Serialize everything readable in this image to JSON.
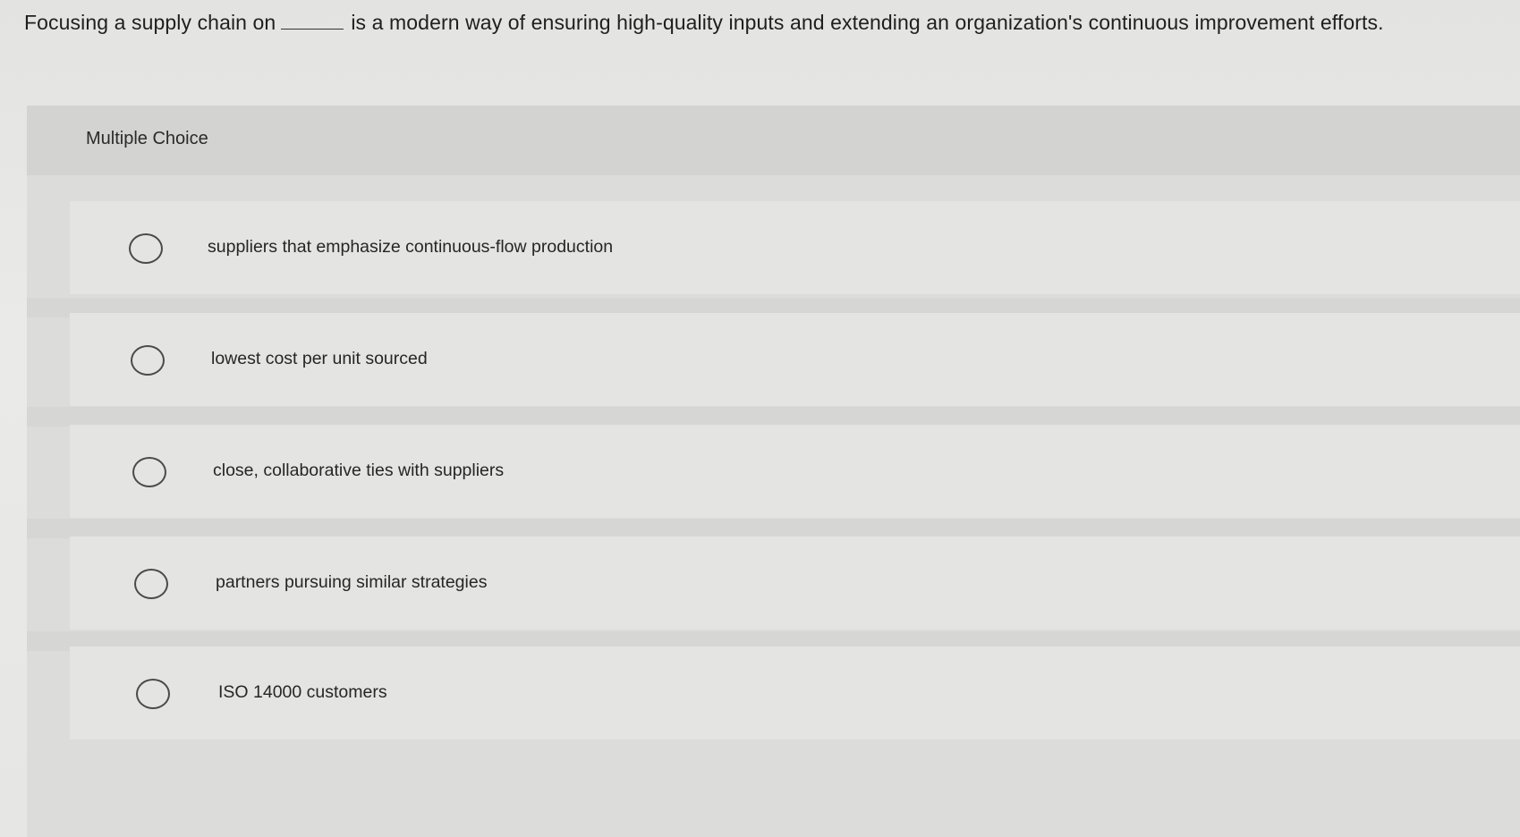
{
  "question": {
    "before_blank": "Focusing a supply chain on",
    "after_blank": "is a modern way of ensuring high-quality inputs and extending an organization's continuous improvement efforts."
  },
  "panel": {
    "title": "Multiple Choice"
  },
  "options": [
    {
      "label": "suppliers that emphasize continuous-flow production"
    },
    {
      "label": "lowest cost per unit sourced"
    },
    {
      "label": "close, collaborative ties with suppliers"
    },
    {
      "label": "partners pursuing similar strategies"
    },
    {
      "label": "ISO 14000 customers"
    }
  ]
}
